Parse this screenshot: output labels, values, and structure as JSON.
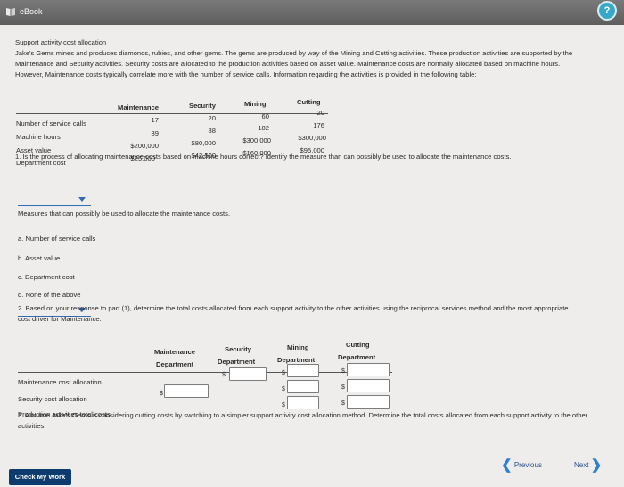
{
  "app": {
    "title": "eBook"
  },
  "problem": {
    "title": "Support activity cost allocation",
    "intro": "Jake's Gems mines and produces diamonds, rubies, and other gems. The gems are produced by way of the Mining and Cutting activities. These production activities are supported by the Maintenance and Security activities. Security costs are allocated to the production activities based on asset value. Maintenance costs are normally allocated based on machine hours. However, Maintenance costs typically correlate more with the number of service calls. Information regarding the activities is provided in the following table:"
  },
  "table": {
    "headers": [
      "Maintenance",
      "Security",
      "Mining",
      "Cutting"
    ],
    "rows": [
      {
        "label": "Number of service calls",
        "values": [
          "17",
          "20",
          "60",
          "20"
        ]
      },
      {
        "label": "Machine hours",
        "values": [
          "89",
          "88",
          "182",
          "176"
        ]
      },
      {
        "label": "Asset value",
        "values": [
          "$200,000",
          "$80,000",
          "$300,000",
          "$300,000"
        ]
      },
      {
        "label": "Department cost",
        "values": [
          "$25,000",
          "$42,500",
          "$160,000",
          "$95,000"
        ]
      }
    ]
  },
  "q1": {
    "text": "1. Is the process of allocating maintenance costs based on machine hours correct? Identify the measure than can possibly be used to allocate the maintenance costs.",
    "measures_heading": "Measures that can possibly be used to allocate the maintenance costs.",
    "options": [
      "a. Number of service calls",
      "b. Asset value",
      "c. Department cost",
      "d. None of the above"
    ]
  },
  "q2": {
    "text": "2. Based on your response to part (1), determine the total costs allocated from each support activity to the other activities using the reciprocal services method and the most appropriate cost driver for Maintenance.",
    "headers": [
      {
        "line1": "Maintenance",
        "line2": "Department"
      },
      {
        "line1": "Security",
        "line2": "Department"
      },
      {
        "line1": "Mining",
        "line2": "Department"
      },
      {
        "line1": "Cutting",
        "line2": "Department"
      }
    ],
    "rows": [
      "Maintenance cost allocation",
      "Security cost allocation",
      "Production activities total costs"
    ],
    "currency": "$"
  },
  "q3": {
    "text": "3. Assume Jake's Gems is considering cutting costs by switching to a simpler support activity cost allocation method. Determine the total costs allocated from each support activity to the other activities."
  },
  "nav": {
    "previous": "Previous",
    "next": "Next",
    "check": "Check My Work"
  },
  "colors": {
    "accent": "#2d7fd0",
    "check_button": "#0d3b6e",
    "help": "#37a8c9"
  }
}
